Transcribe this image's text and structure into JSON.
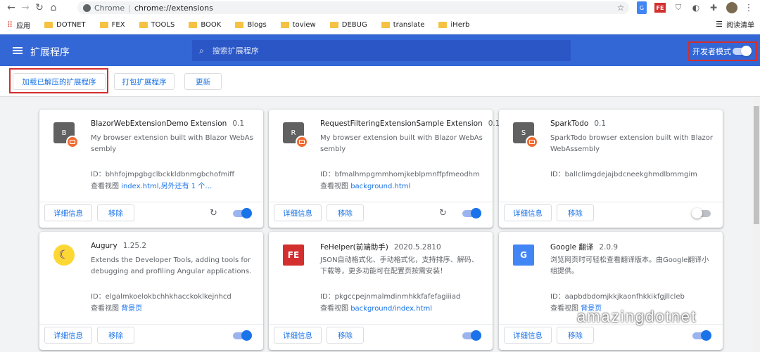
{
  "browser": {
    "tab_host": "Chrome",
    "url": "chrome://extensions"
  },
  "bookmarks": [
    {
      "label": "应用",
      "kind": "apps"
    },
    {
      "label": "DOTNET"
    },
    {
      "label": "FEX"
    },
    {
      "label": "TOOLS"
    },
    {
      "label": "BOOK"
    },
    {
      "label": "Blogs"
    },
    {
      "label": "toview"
    },
    {
      "label": "DEBUG"
    },
    {
      "label": "translate"
    },
    {
      "label": "iHerb"
    }
  ],
  "reading_list": "阅读清单",
  "header": {
    "title": "扩展程序",
    "search_placeholder": "搜索扩展程序",
    "dev_mode_label": "开发者模式",
    "dev_mode": true
  },
  "toolbar": {
    "load_unpacked": "加载已解压的扩展程序",
    "pack": "打包扩展程序",
    "update": "更新"
  },
  "labels": {
    "details": "详细信息",
    "remove": "移除",
    "id_prefix": "ID：",
    "views_prefix": "查看视图"
  },
  "extensions": [
    {
      "name": "BlazorWebExtensionDemo Extension",
      "version": "0.1",
      "icon_letter": "B",
      "description": "My browser extension built with Blazor WebAssembly",
      "id": "bhhfojmpgbgclbckkldbnmgbchofmiff",
      "views": "index.html,另外还有 1 个…",
      "enabled": true,
      "reload": true
    },
    {
      "name": "RequestFilteringExtensionSample Extension",
      "version": "0.1",
      "icon_letter": "R",
      "description": "My browser extension built with Blazor WebAssembly",
      "id": "bfmalhmpgmmhomjkeblpmnffpfmeodhm",
      "views": "background.html",
      "enabled": true,
      "reload": true
    },
    {
      "name": "SparkTodo",
      "version": "0.1",
      "icon_letter": "S",
      "description": "SparkTodo browser extension built with Blazor WebAssembly",
      "id": "ballclimgdejajbdcneekghmdlbmmgim",
      "views": "",
      "enabled": false,
      "reload": false
    },
    {
      "name": "Augury",
      "version": "1.25.2",
      "icon_letter": "☾",
      "description": "Extends the Developer Tools, adding tools for debugging and profiling Angular applications.",
      "id": "elgalmkoelokbchhkhacckoklkejnhcd",
      "views": "背景页",
      "enabled": true,
      "reload": false
    },
    {
      "name": "FeHelper(前端助手)",
      "version": "2020.5.2810",
      "icon_letter": "FE",
      "description": "JSON自动格式化、手动格式化，支持排序、解码、下载等，更多功能可在配置页按需安装！",
      "id": "pkgccpejnmalmdinmhkkfafefagiiiad",
      "views": "background/index.html",
      "enabled": true,
      "reload": false
    },
    {
      "name": "Google 翻译",
      "version": "2.0.9",
      "icon_letter": "G",
      "description": "浏览网页时可轻松查看翻译版本。由Google翻译小组提供。",
      "id": "aapbdbdomjkkjkaonfhkkikfgjllcleb",
      "views": "背景页",
      "enabled": true,
      "reload": false
    }
  ],
  "watermark": "amazingdotnet"
}
